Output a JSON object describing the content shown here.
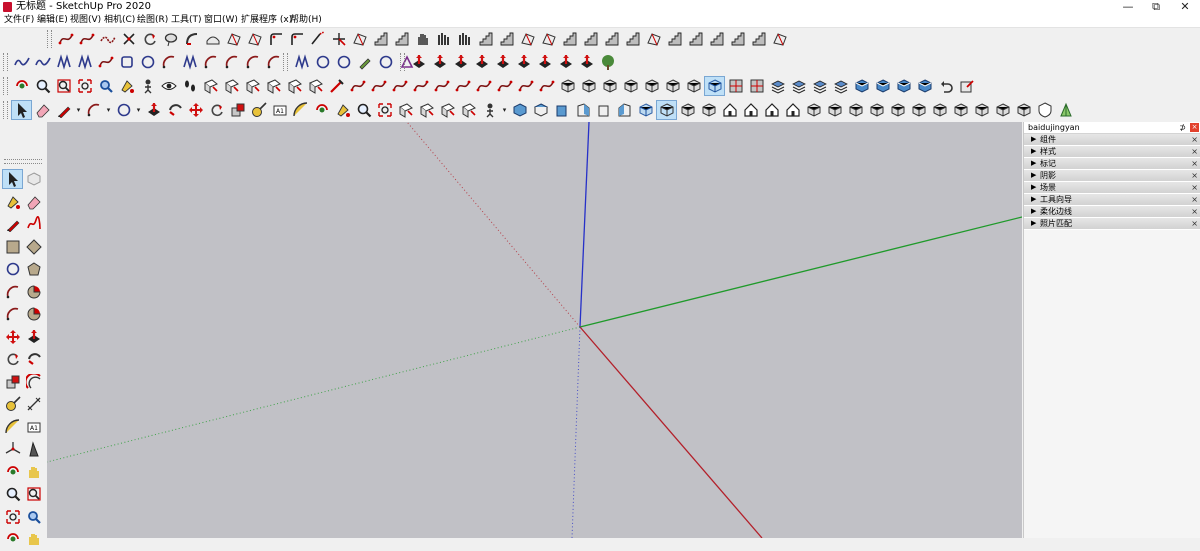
{
  "window": {
    "title": "无标题 - SketchUp Pro 2020",
    "minimize_glyph": "—",
    "maximize_glyph": "⧉",
    "close_glyph": "✕"
  },
  "menu": [
    "文件(F)",
    "编辑(E)",
    "视图(V)",
    "相机(C)",
    "绘图(R)",
    "工具(T)",
    "窗口(W)",
    "扩展程序 (x)",
    "帮助(H)"
  ],
  "toolbars": {
    "row1": [
      "curve-tool",
      "curve-tool",
      "spline-tool",
      "cut-tool",
      "rotate-tool",
      "lasso-tool",
      "bend-tool",
      "shape-tool",
      "plugin-tool",
      "plugin-tool",
      "fillet-tool",
      "fillet-tool",
      "extend-tool",
      "trim-tool",
      "plugin-tool",
      "stair-tool",
      "stair-tool",
      "hand-tool",
      "bars-tool",
      "bars-tool",
      "stair-tool",
      "stair-tool",
      "plugin-tool",
      "plugin-tool",
      "stair-tool",
      "stair-tool",
      "stair-tool",
      "stair-tool",
      "plugin-tool",
      "stair-tool",
      "stair-tool",
      "stair-tool",
      "stair-tool",
      "stair-tool",
      "plugin-tool"
    ],
    "row2_left": [
      "wave-tool",
      "wave-tool",
      "zigzag-tool",
      "zigzag-tool",
      "curve-tool",
      "square-tool",
      "circle-tool",
      "arc-tool",
      "zigzag-tool",
      "arc-tool",
      "arc-tool",
      "arc-tool",
      "arc-tool"
    ],
    "row2_mid": [
      "zigzag-tool",
      "circle-tool",
      "circle-tool",
      "pen-tool",
      "circle-tool",
      "triangle-tool"
    ],
    "row2_right": [
      "push-tool",
      "push-tool",
      "push-tool",
      "push-tool",
      "push-tool",
      "push-tool",
      "push-tool",
      "push-tool",
      "push-tool",
      "tree-tool"
    ],
    "row3": [
      "orbit-tool",
      "zoom-tool",
      "zoom-window-tool",
      "zoom-extents-tool",
      "search-tool",
      "paint-tool",
      "person-tool",
      "eye-tool",
      "footprints-tool",
      "section-tool",
      "section-tool",
      "section-tool",
      "section-tool",
      "section-tool",
      "section-tool",
      "knife-tool",
      "curve-tool",
      "curve-tool",
      "curve-tool",
      "curve-tool",
      "curve-tool",
      "curve-tool",
      "curve-tool",
      "curve-tool",
      "curve-tool",
      "curve-tool",
      "cube-tool",
      "cube-tool",
      "cube-tool",
      "cube-tool",
      "cube-tool",
      "cube-tool",
      "cube-tool",
      "xray-tool",
      "texture-tool",
      "texture-tool",
      "layers-tool",
      "layers-tool",
      "layers-tool",
      "layers-tool",
      "view-tool",
      "view-tool",
      "view-tool",
      "view-tool",
      "undo-tool",
      "export-tool"
    ],
    "row4": [
      "select-tool",
      "eraser-tool",
      "pencil-tool",
      "arc-tool",
      "circle-tool",
      "push-tool",
      "follow-tool",
      "move-tool",
      "rotate-tool",
      "scale-tool",
      "tape-tool",
      "text-tool",
      "protractor-tool",
      "orbit-tool",
      "paint-tool",
      "zoom-tool",
      "zoom-extents-tool",
      "section-tool",
      "section-tool",
      "section-tool",
      "section-tool",
      "person-tool",
      "view-iso-tool",
      "view-top-tool",
      "view-front-tool",
      "view-right-tool",
      "view-back-tool",
      "view-left-tool",
      "xray-tool",
      "wireframe-tool",
      "cube-tool",
      "cube-tool",
      "home-tool",
      "home-tool",
      "home-tool",
      "home-tool",
      "cube-tool",
      "cube-tool",
      "cube-tool",
      "cube-tool",
      "cube-tool",
      "cube-tool",
      "cube-tool",
      "cube-tool",
      "cube-tool",
      "cube-tool",
      "cube-tool",
      "shield-tool",
      "leaf-tool"
    ]
  },
  "left_toolbar": [
    [
      "select-tool",
      "component-tool"
    ],
    [
      "paint-tool",
      "eraser-tool"
    ],
    [
      "pencil-tool",
      "freehand-tool"
    ],
    [
      "rectangle-tool",
      "rotated-rect-tool"
    ],
    [
      "circle-tool",
      "polygon-tool"
    ],
    [
      "arc-tool",
      "pie-tool"
    ],
    [
      "arc-tool",
      "pie-tool"
    ],
    [
      "move-tool",
      "push-tool"
    ],
    [
      "rotate-tool",
      "follow-tool"
    ],
    [
      "scale-tool",
      "offset-tool"
    ],
    [
      "tape-tool",
      "dimension-tool"
    ],
    [
      "protractor-tool",
      "text-tool"
    ],
    [
      "axes-tool",
      "3dtext-tool"
    ],
    [
      "orbit-tool",
      "pan-tool"
    ],
    [
      "zoom-tool",
      "zoom-window-tool"
    ],
    [
      "zoom-extents-tool",
      "search-tool"
    ],
    [
      "orbit-tool",
      "pan-tool"
    ]
  ],
  "tray": {
    "title": "baidujingyan",
    "pin_glyph": "⊅",
    "close_glyph": "×",
    "panels": [
      {
        "arrow": "▶",
        "label": "组件",
        "close": "×"
      },
      {
        "arrow": "▶",
        "label": "样式",
        "close": "×"
      },
      {
        "arrow": "▶",
        "label": "标记",
        "close": "×"
      },
      {
        "arrow": "▶",
        "label": "阴影",
        "close": "×"
      },
      {
        "arrow": "▶",
        "label": "场景",
        "close": "×"
      },
      {
        "arrow": "▶",
        "label": "工具向导",
        "close": "×"
      },
      {
        "arrow": "▶",
        "label": "柔化边线",
        "close": "×"
      },
      {
        "arrow": "▶",
        "label": "照片匹配",
        "close": "×"
      }
    ]
  },
  "colors": {
    "canvas_bg": "#c1c1c6",
    "axis_red": "#b3202a",
    "axis_green": "#1f9a2a",
    "axis_blue": "#2630c8",
    "brand_red": "#c8102e"
  }
}
